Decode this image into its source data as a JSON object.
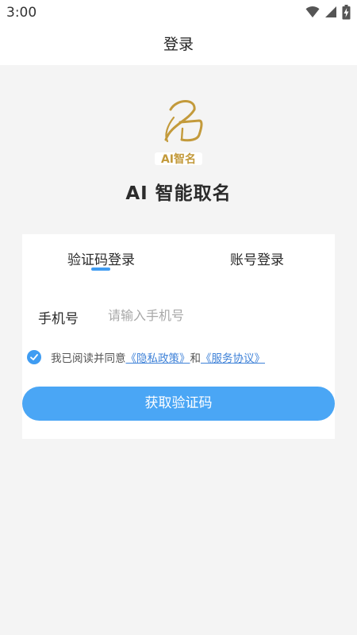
{
  "status_bar": {
    "time": "3:00",
    "icons": [
      "wifi-icon",
      "cellular-signal-icon",
      "battery-charging-icon"
    ]
  },
  "header": {
    "title": "登录"
  },
  "app": {
    "logo_text": "AI智名",
    "name": "AI 智能取名"
  },
  "login_card": {
    "tabs": [
      {
        "label": "验证码登录",
        "active": true
      },
      {
        "label": "账号登录",
        "active": false
      }
    ],
    "phone": {
      "label": "手机号",
      "value": "",
      "placeholder": "请输入手机号"
    },
    "agreement": {
      "checked": true,
      "prefix": "我已阅读并同意",
      "privacy_link": "《隐私政策》",
      "conjunction": "和",
      "service_link": "《服务协议》"
    },
    "submit_label": "获取验证码"
  },
  "colors": {
    "accent": "#3f9cf2",
    "button": "#4aa6f5",
    "link": "#3f82d8",
    "logo_gold": "#c39a3b",
    "background": "#f4f4f4"
  }
}
